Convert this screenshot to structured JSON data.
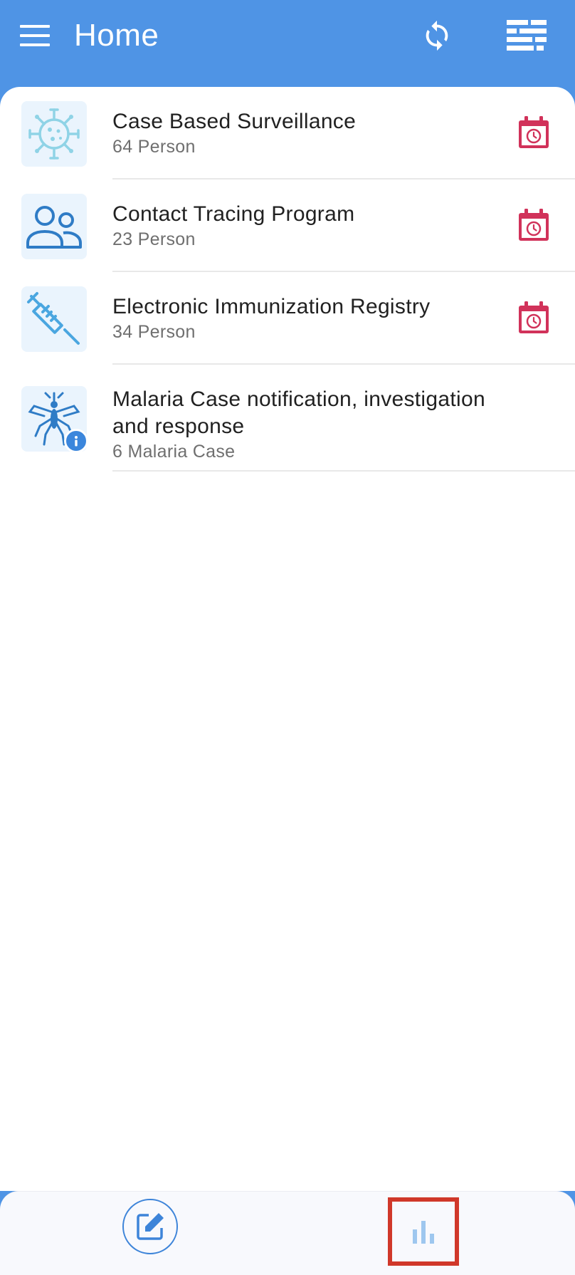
{
  "toolbar": {
    "title": "Home",
    "menu_icon": "hamburger-menu-icon",
    "sync_icon": "sync-icon",
    "filter_icon": "filter-icon"
  },
  "programs": [
    {
      "name": "Case Based Surveillance",
      "count": "64 Person",
      "icon": "virus-icon",
      "action_icon": "calendar-alarm-icon"
    },
    {
      "name": "Contact Tracing Program",
      "count": "23 Person",
      "icon": "people-icon",
      "action_icon": "calendar-alarm-icon"
    },
    {
      "name": "Electronic Immunization Registry",
      "count": "34 Person",
      "icon": "syringe-icon",
      "action_icon": "calendar-alarm-icon"
    },
    {
      "name": "Malaria Case notification, investigation and response",
      "count": "6 Malaria Case",
      "icon": "mosquito-icon",
      "badge_icon": "info-icon"
    }
  ],
  "bottom_nav": {
    "items": [
      {
        "icon": "edit-note-icon",
        "selected": true
      },
      {
        "icon": "bar-chart-icon",
        "selected": false
      }
    ]
  },
  "colors": {
    "primary": "#4f94e5",
    "calendar": "#d1325a",
    "highlight_border": "#d0382a",
    "text_primary": "#212121",
    "text_secondary": "#6f6f6f"
  }
}
